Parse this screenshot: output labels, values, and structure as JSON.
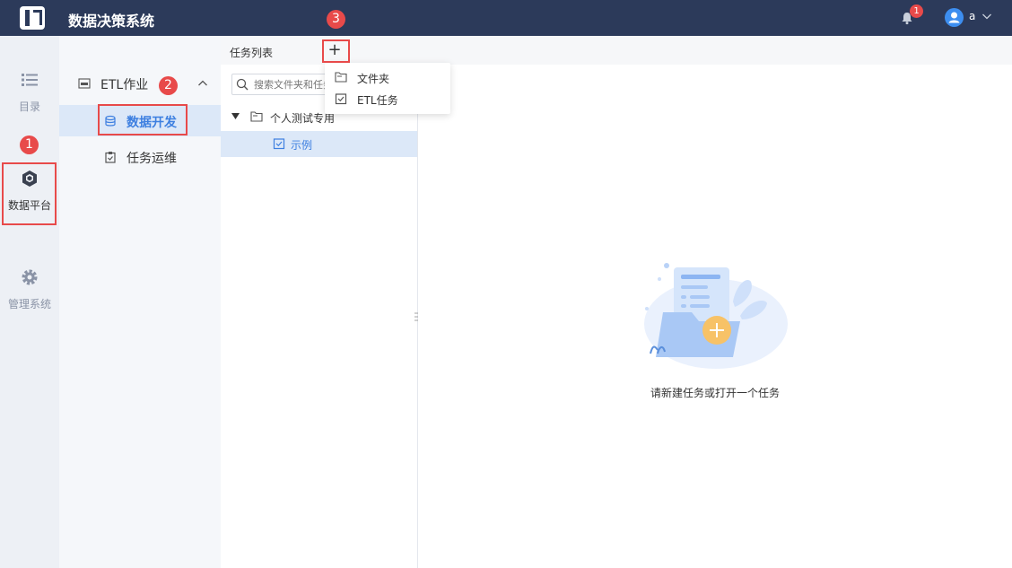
{
  "topbar": {
    "app_title": "数据决策系统",
    "notification_count": "1",
    "user_name": "a"
  },
  "rail": {
    "items": [
      {
        "label": "目录",
        "icon": "list-icon"
      },
      {
        "label": "数据平台",
        "icon": "cube-icon"
      },
      {
        "label": "管理系统",
        "icon": "gear-icon"
      }
    ]
  },
  "nav": {
    "group_label": "ETL作业",
    "items": [
      {
        "label": "数据开发",
        "icon": "database-icon",
        "active": true
      },
      {
        "label": "任务运维",
        "icon": "clipboard-icon",
        "active": false
      }
    ]
  },
  "tasks": {
    "header_label": "任务列表",
    "add_glyph": "+",
    "search_placeholder": "搜索文件夹和任务",
    "tree": [
      {
        "label": "个人测试专用",
        "type": "folder",
        "expanded": true
      },
      {
        "label": "示例",
        "type": "task"
      }
    ]
  },
  "dropdown": {
    "items": [
      {
        "label": "文件夹",
        "icon": "folder-icon"
      },
      {
        "label": "ETL任务",
        "icon": "task-check-icon"
      }
    ]
  },
  "main": {
    "empty_message": "请新建任务或打开一个任务"
  },
  "callouts": [
    "1",
    "2",
    "3"
  ],
  "colors": {
    "topbar": "#2c3a5a",
    "accent": "#3d8ef0",
    "highlight": "#e84a4a",
    "active_nav_bg": "#dce8f8",
    "active_text": "#3d7fe0"
  }
}
